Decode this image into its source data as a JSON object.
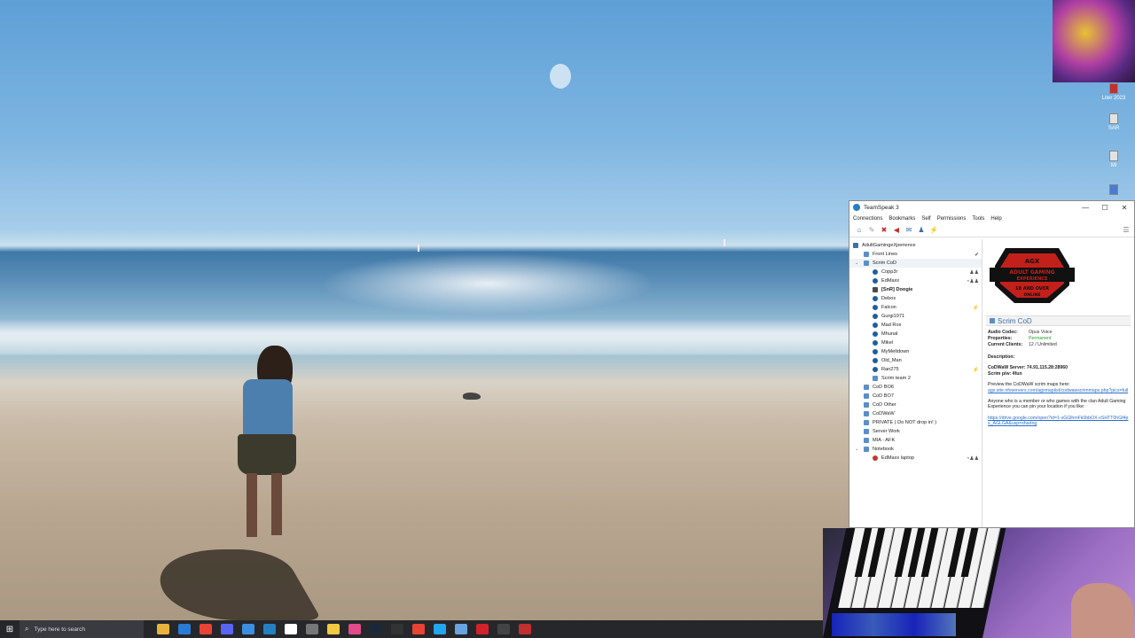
{
  "teamspeak": {
    "title": "TeamSpeak 3",
    "window_controls": {
      "minimize": "—",
      "maximize": "☐",
      "close": "✕"
    },
    "menu": [
      "Connections",
      "Bookmarks",
      "Self",
      "Permissions",
      "Tools",
      "Help"
    ],
    "toolbar_icons": [
      "connect-icon",
      "away-icon",
      "mute-mic-icon",
      "mute-speakers-icon",
      "whisper-icon",
      "contacts-icon",
      "subscribe-icon",
      "settings-icon"
    ],
    "tree": {
      "server": "AdultGamingeXperience",
      "rows": [
        {
          "name": "Front Lines",
          "type": "channel",
          "indent": 1,
          "flag": "✔"
        },
        {
          "name": "Scrim CoD",
          "type": "channel",
          "indent": 1,
          "expanded": true
        },
        {
          "name": "Copp3r",
          "type": "user",
          "indent": 2,
          "flag": "♟♟"
        },
        {
          "name": "EdMaxx",
          "type": "user",
          "indent": 2,
          "flag": "◔♟♟"
        },
        {
          "name": "[SnR] Doogie",
          "type": "me",
          "indent": 2,
          "bold": true
        },
        {
          "name": "Debox",
          "type": "user",
          "indent": 2
        },
        {
          "name": "Falcon",
          "type": "user",
          "indent": 2,
          "flag": "⚡"
        },
        {
          "name": "Gurgi1971",
          "type": "user",
          "indent": 2
        },
        {
          "name": "Mad Rox",
          "type": "user",
          "indent": 2
        },
        {
          "name": "Mhunal",
          "type": "user",
          "indent": 2
        },
        {
          "name": "Mikel",
          "type": "user",
          "indent": 2
        },
        {
          "name": "MyMeltdown",
          "type": "user",
          "indent": 2
        },
        {
          "name": "Old_Man",
          "type": "user",
          "indent": 2
        },
        {
          "name": "Ran275",
          "type": "user",
          "indent": 2,
          "flag": "⚡"
        },
        {
          "name": "Scrim team 2",
          "type": "channel",
          "indent": 2
        },
        {
          "name": "CoD BO6",
          "type": "channel",
          "indent": 1
        },
        {
          "name": "CoD BO7",
          "type": "channel",
          "indent": 1
        },
        {
          "name": "CoD Other",
          "type": "channel",
          "indent": 1
        },
        {
          "name": "CoDWaW",
          "type": "channel",
          "indent": 1
        },
        {
          "name": "PRIVATE ( Do NOT drop in! )",
          "type": "channel",
          "indent": 1
        },
        {
          "name": "Server Work",
          "type": "channel",
          "indent": 1
        },
        {
          "name": "MIA - AFK",
          "type": "channel",
          "indent": 1
        },
        {
          "name": "Notebook",
          "type": "channel",
          "indent": 1,
          "expanded": true
        },
        {
          "name": "EdMaxx laptop",
          "type": "away",
          "indent": 2,
          "flag": "◔♟♟"
        }
      ]
    },
    "info": {
      "banner_lines": [
        "AGX",
        "ADULT GAMING",
        "EXPERIENCE",
        "18 AND OVER",
        "ONLINE"
      ],
      "channel_name": "Scrim CoD",
      "fields": [
        {
          "k": "Audio Codec:",
          "v": "Opus Voice"
        },
        {
          "k": "Properties:",
          "v": "Permanent",
          "green": true
        },
        {
          "k": "Current Clients:",
          "v": "12 / Unlimited"
        }
      ],
      "description_label": "Description:",
      "server_line": "CoDWaW Server: 74.91.115.28:28960",
      "scrim_line": "Scrim p/w: 4fun",
      "maps_text": "Preview the CoDWaW scrim maps here:",
      "maps_link": "agx.site.nfoservers.com/agxmaplist/codwawscrimmaps.php?pics=full",
      "members_text": "Anyone who is a member or who games with the clan Adult Gaming Experience you can pin your location if you like:",
      "drive_link": "https://drive.google.com/open?id=1-vGGlhmFk0bbOX-xSHTT0hGf4ps_AGLGA&usp=sharing"
    }
  },
  "desktop_icons": [
    {
      "label": "Liter 2023",
      "icon": "folder-icon"
    },
    {
      "label": "SAR",
      "icon": "file-icon"
    },
    {
      "label": "Mi",
      "icon": "file-icon"
    }
  ],
  "taskbar": {
    "search_placeholder": "Type here to search",
    "apps": [
      "file-explorer-icon",
      "mail-icon",
      "chrome-icon",
      "discord-icon",
      "photos-icon",
      "teamspeak-icon",
      "malwarebytes-icon",
      "notepad-icon",
      "pencil-icon",
      "itunes-icon",
      "steam-icon",
      "epic-icon",
      "chrome-2-icon",
      "vscode-icon",
      "calculator-icon",
      "acrobat-icon",
      "obs-icon",
      "gauge-icon"
    ]
  },
  "colors": {
    "accent": "#2580c3",
    "taskbar": "#26272b",
    "link": "#2a6fc9"
  }
}
